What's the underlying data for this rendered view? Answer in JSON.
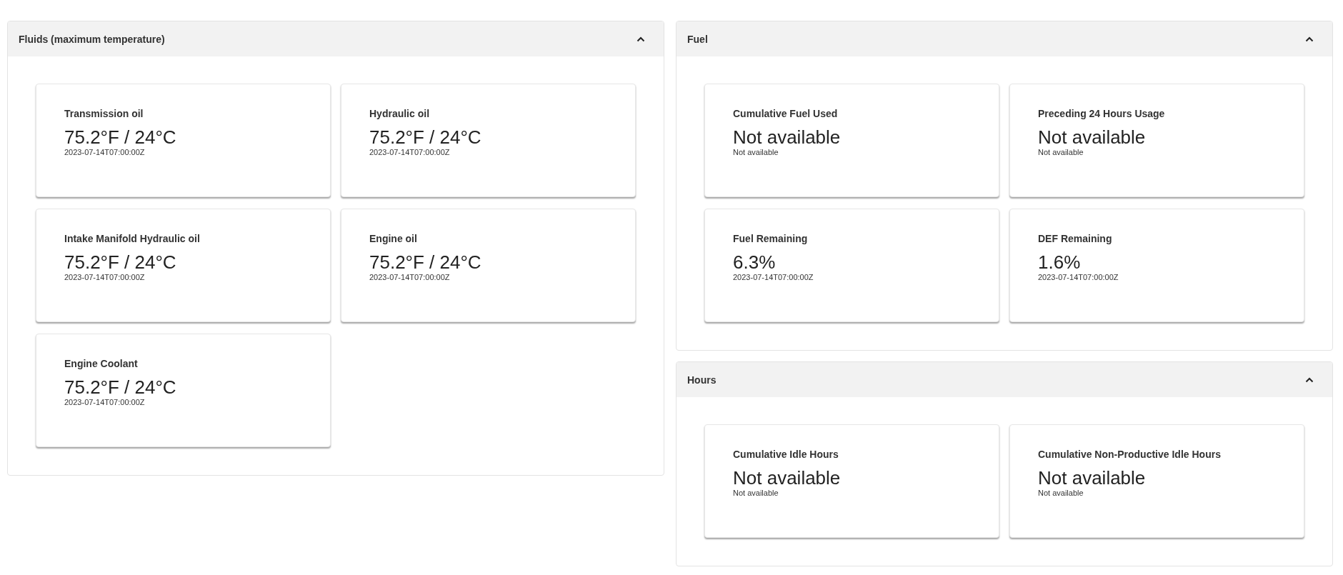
{
  "columns": [
    [
      {
        "title": "Fluids (maximum temperature)",
        "expanded": true,
        "cards": [
          {
            "label": "Transmission oil",
            "value": "75.2°F / 24°C",
            "timestamp": "2023-07-14T07:00:00Z"
          },
          {
            "label": "Hydraulic oil",
            "value": "75.2°F / 24°C",
            "timestamp": "2023-07-14T07:00:00Z"
          },
          {
            "label": "Intake Manifold Hydraulic oil",
            "value": "75.2°F / 24°C",
            "timestamp": "2023-07-14T07:00:00Z"
          },
          {
            "label": "Engine oil",
            "value": "75.2°F / 24°C",
            "timestamp": "2023-07-14T07:00:00Z"
          },
          {
            "label": "Engine Coolant",
            "value": "75.2°F / 24°C",
            "timestamp": "2023-07-14T07:00:00Z"
          }
        ]
      }
    ],
    [
      {
        "title": "Fuel",
        "expanded": true,
        "cards": [
          {
            "label": "Cumulative Fuel Used",
            "value": "Not available",
            "timestamp": "Not available"
          },
          {
            "label": "Preceding 24 Hours Usage",
            "value": "Not available",
            "timestamp": "Not available"
          },
          {
            "label": "Fuel Remaining",
            "value": "6.3%",
            "timestamp": "2023-07-14T07:00:00Z"
          },
          {
            "label": "DEF Remaining",
            "value": "1.6%",
            "timestamp": "2023-07-14T07:00:00Z"
          }
        ]
      },
      {
        "title": "Hours",
        "expanded": true,
        "cards": [
          {
            "label": "Cumulative Idle Hours",
            "value": "Not available",
            "timestamp": "Not available"
          },
          {
            "label": "Cumulative Non-Productive Idle Hours",
            "value": "Not available",
            "timestamp": "Not available"
          }
        ]
      }
    ]
  ]
}
